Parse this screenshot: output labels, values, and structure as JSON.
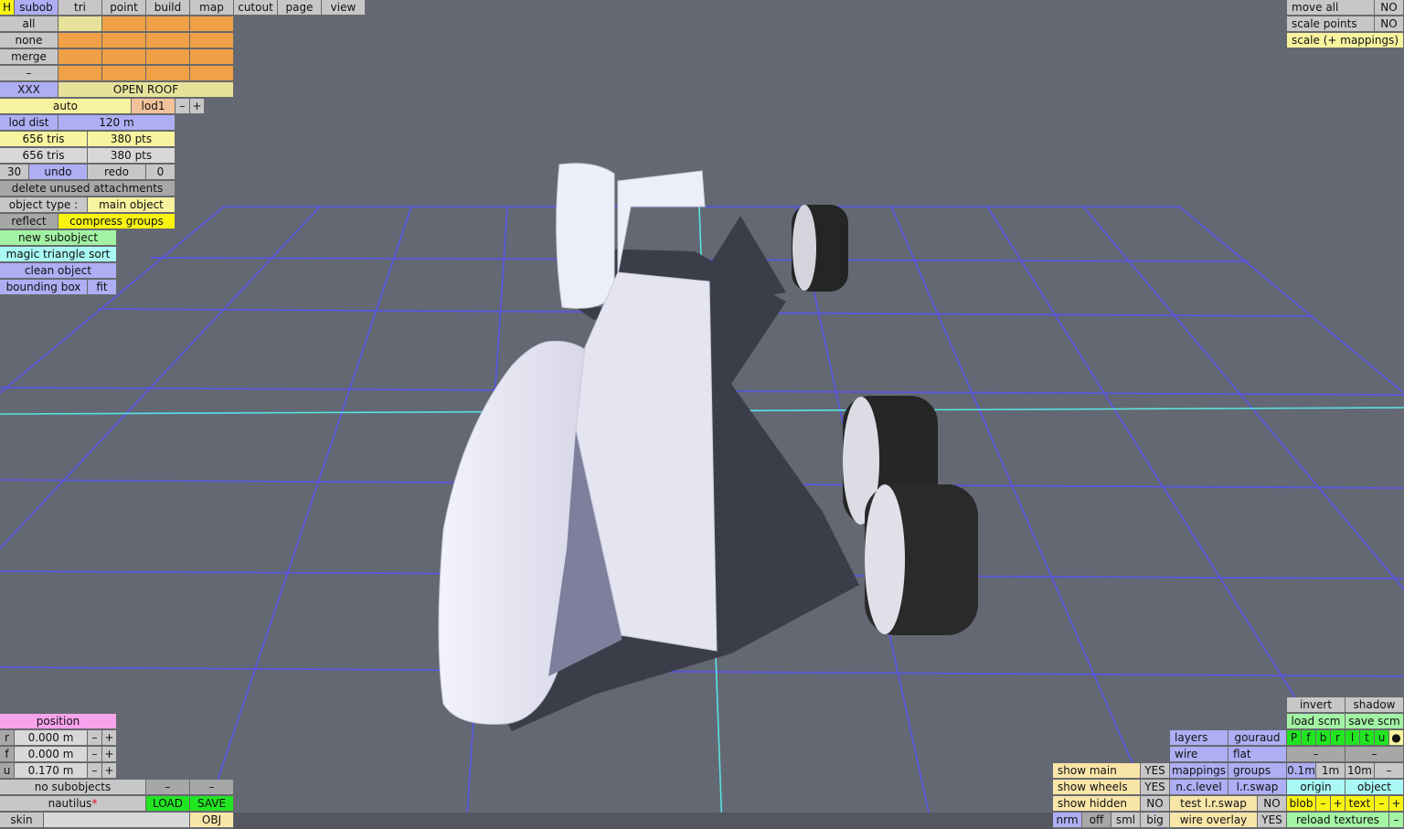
{
  "menu": {
    "h": "H",
    "subob": "subob",
    "tri": "tri",
    "point": "point",
    "build": "build",
    "map": "map",
    "cutout": "cutout",
    "page": "page",
    "view": "view"
  },
  "selection": {
    "all": "all",
    "none": "none",
    "merge": "merge",
    "dash": "–"
  },
  "subobject_name": {
    "id": "XXX",
    "name": "OPEN ROOF"
  },
  "lod": {
    "auto": "auto",
    "level": "lod1",
    "minus": "–",
    "plus": "+",
    "dist_label": "lod dist",
    "dist_value": "120 m"
  },
  "counts": {
    "tris_a": "656 tris",
    "pts_a": "380 pts",
    "tris_b": "656 tris",
    "pts_b": "380 pts"
  },
  "history": {
    "undo_count": "30",
    "undo": "undo",
    "redo": "redo",
    "redo_count": "0"
  },
  "tools": {
    "delete_unused": "delete unused attachments",
    "object_type_label": "object type :",
    "object_type_value": "main object",
    "reflect": "reflect",
    "compress_groups": "compress groups",
    "new_subobject": "new subobject",
    "magic_sort": "magic triangle sort",
    "clean_object": "clean object",
    "bounding_box": "bounding box",
    "fit": "fit"
  },
  "position": {
    "title": "position",
    "rows": [
      {
        "axis": "r",
        "value": "0.000 m"
      },
      {
        "axis": "f",
        "value": "0.000 m"
      },
      {
        "axis": "u",
        "value": "0.170 m"
      }
    ],
    "minus": "–",
    "plus": "+"
  },
  "file": {
    "no_subobjects": "no subobjects",
    "dash": "–",
    "name": "nautilus",
    "star": "*",
    "load": "LOAD",
    "save": "SAVE",
    "skin": "skin",
    "obj": "OBJ"
  },
  "top_right": {
    "move_all": "move all",
    "move_all_val": "NO",
    "scale_points": "scale points",
    "scale_points_val": "NO",
    "scale_mappings": "scale (+ mappings)"
  },
  "display": {
    "show_main": "show main",
    "show_main_val": "YES",
    "show_wheels": "show wheels",
    "show_wheels_val": "YES",
    "show_hidden": "show hidden",
    "show_hidden_val": "NO",
    "nrm": "nrm",
    "off": "off",
    "sml": "sml",
    "big": "big"
  },
  "render": {
    "layers": "layers",
    "gouraud": "gouraud",
    "wire": "wire",
    "flat": "flat",
    "mappings": "mappings",
    "groups": "groups",
    "nc_level": "n.c.level",
    "lr_swap": "l.r.swap",
    "test_lr_swap": "test l.r.swap",
    "test_val": "NO",
    "wire_overlay": "wire overlay",
    "wire_overlay_val": "YES"
  },
  "scm": {
    "invert": "invert",
    "shadow": "shadow",
    "load_scm": "load scm",
    "save_scm": "save scm",
    "flags": [
      "P",
      "f",
      "b",
      "r",
      "l",
      "t",
      "u"
    ],
    "dot": "●",
    "dash": "–",
    "grid": [
      "0.1m",
      "1m",
      "10m"
    ],
    "origin": "origin",
    "object": "object",
    "blob": "blob",
    "text": "text",
    "minus": "–",
    "plus": "+",
    "reload": "reload textures"
  },
  "colors": {
    "background": "#646873",
    "grid": "#5454e6",
    "axis": "#58e3e3",
    "body": "#e9e9f6",
    "tyre": "#222222",
    "shadow": "#3c3f4b"
  }
}
